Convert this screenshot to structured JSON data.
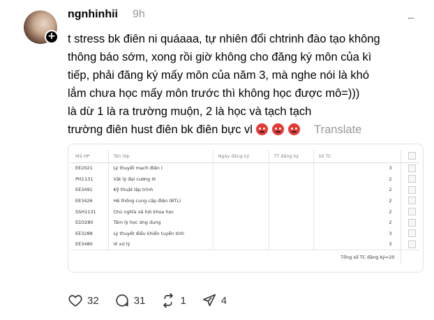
{
  "post": {
    "username": "ngnhinhii",
    "time": "9h",
    "more_label": "...",
    "lines": [
      "t stress bk điên ni quáaaa, tự nhiên đổi chtrinh đào tạo không",
      "thông báo sớm, xong rồi giờ không cho đăng ký môn của kì",
      "tiếp, phải đăng ký mấy môn của năm 3, mà nghe nói là khó",
      "lắm chưa học mấy môn trước thì không học được mô=)))",
      "là dừ 1 là ra trường muộn, 2 là học và tạch tạch",
      "trường điên hust điên bk điên bực vl"
    ],
    "emoji_name": "angry-face-emoji",
    "translate_label": "Translate"
  },
  "table": {
    "headers": [
      "Mã HP",
      "Tên lớp",
      "Ngày đăng ký",
      "TT đăng ký",
      "Số TC"
    ],
    "rows": [
      [
        "EE2021",
        "Lý thuyết mạch điện I",
        "",
        "",
        "3"
      ],
      [
        "PH1131",
        "Vật lý đại cương III",
        "",
        "",
        "2"
      ],
      [
        "EE3491",
        "Kỹ thuật lập trình",
        "",
        "",
        "2"
      ],
      [
        "EE3426",
        "Hệ thống cung cấp điện (BTL)",
        "",
        "",
        "2"
      ],
      [
        "SSH1131",
        "Chủ nghĩa xã hội khoa học",
        "",
        "",
        "2"
      ],
      [
        "ED3280",
        "Tâm lý học ứng dụng",
        "",
        "",
        "2"
      ],
      [
        "EE3288",
        "Lý thuyết điều khiển tuyến tính",
        "",
        "",
        "3"
      ],
      [
        "EE3480",
        "Vi xử lý",
        "",
        "",
        "3"
      ]
    ],
    "total_label": "Tổng số TC đăng ký=20"
  },
  "actions": {
    "likes": "32",
    "replies": "31",
    "reposts": "1",
    "shares": "4"
  }
}
